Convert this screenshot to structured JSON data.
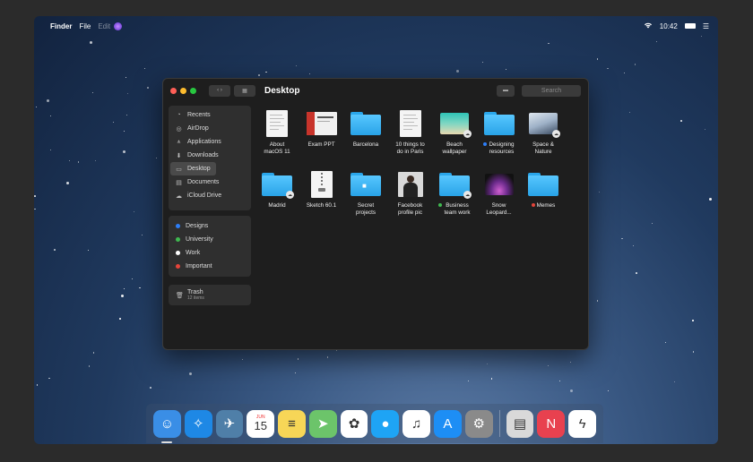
{
  "menubar": {
    "apple_icon": "apple-icon",
    "app_name": "Finder",
    "items": [
      "File",
      "Edit"
    ],
    "time": "10:42"
  },
  "window": {
    "title": "Desktop",
    "search_placeholder": "Search"
  },
  "sidebar": {
    "favorites": [
      {
        "label": "Recents",
        "icon": "clock-icon",
        "glyph": "◔"
      },
      {
        "label": "AirDrop",
        "icon": "airdrop-icon",
        "glyph": "◎"
      },
      {
        "label": "Applications",
        "icon": "applications-icon",
        "glyph": "⩚"
      },
      {
        "label": "Downloads",
        "icon": "downloads-icon",
        "glyph": "⬇"
      },
      {
        "label": "Desktop",
        "icon": "desktop-icon",
        "glyph": "▭",
        "selected": true
      },
      {
        "label": "Documents",
        "icon": "documents-icon",
        "glyph": "▤"
      },
      {
        "label": "iCloud Drive",
        "icon": "cloud-icon",
        "glyph": "☁"
      }
    ],
    "tags": [
      {
        "label": "Designs",
        "color": "#2d7ef7"
      },
      {
        "label": "University",
        "color": "#3fb950"
      },
      {
        "label": "Work",
        "color": "#ffffff"
      },
      {
        "label": "Important",
        "color": "#e5443a"
      }
    ],
    "trash": {
      "label": "Trash",
      "sub": "12 items"
    }
  },
  "files": [
    {
      "line1": "About",
      "line2": "macOS 11",
      "kind": "doc"
    },
    {
      "line1": "Exam PPT",
      "line2": "",
      "kind": "ppt"
    },
    {
      "line1": "Barcelona",
      "line2": "",
      "kind": "folder"
    },
    {
      "line1": "10 things to",
      "line2": "do in Paris",
      "kind": "doc"
    },
    {
      "line1": "Beach",
      "line2": "wallpaper",
      "kind": "beach",
      "cloud": true
    },
    {
      "line1": "Designing",
      "line2": "resources",
      "kind": "folder",
      "tag": "#2d7ef7"
    },
    {
      "line1": "Space &",
      "line2": "Nature",
      "kind": "space",
      "cloud": true
    },
    {
      "line1": "Madrid",
      "line2": "",
      "kind": "folder",
      "cloud": true
    },
    {
      "line1": "Sketch 60.1",
      "line2": "",
      "kind": "zip"
    },
    {
      "line1": "Secret",
      "line2": "projects",
      "kind": "folder-lock"
    },
    {
      "line1": "Facebook",
      "line2": "profile pic",
      "kind": "portrait"
    },
    {
      "line1": "Business",
      "line2": "team work",
      "kind": "folder",
      "cloud": true,
      "tag": "#3fb950"
    },
    {
      "line1": "Snow",
      "line2": "Leopard...",
      "kind": "leopard"
    },
    {
      "line1": "Memes",
      "line2": "",
      "kind": "folder",
      "tag": "#e5443a"
    }
  ],
  "dock": [
    {
      "name": "finder-icon",
      "color": "#3a8ee6",
      "glyph": "☺",
      "running": true
    },
    {
      "name": "safari-icon",
      "color": "#1e88e5",
      "glyph": "✧"
    },
    {
      "name": "preview-icon",
      "color": "#4f7fa8",
      "glyph": "✈"
    },
    {
      "name": "calendar-icon",
      "color": "#ffffff",
      "glyph": "15",
      "top": "JUN"
    },
    {
      "name": "notes-icon",
      "color": "#f7d657",
      "glyph": "≡"
    },
    {
      "name": "maps-icon",
      "color": "#6cc46a",
      "glyph": "➤"
    },
    {
      "name": "photos-icon",
      "color": "#ffffff",
      "glyph": "✿"
    },
    {
      "name": "messages-icon",
      "color": "#1ea4f5",
      "glyph": "●"
    },
    {
      "name": "music-icon",
      "color": "#ffffff",
      "glyph": "♫"
    },
    {
      "name": "app-store-icon",
      "color": "#1d8ef5",
      "glyph": "A"
    },
    {
      "name": "system-preferences-icon",
      "color": "#8a8a8a",
      "glyph": "⚙"
    },
    {
      "name": "sep"
    },
    {
      "name": "documents-stack-icon",
      "color": "#d9d9d9",
      "glyph": "▤"
    },
    {
      "name": "news-icon",
      "color": "#e8414f",
      "glyph": "N"
    },
    {
      "name": "messenger-icon",
      "color": "#ffffff",
      "glyph": "ϟ"
    }
  ]
}
